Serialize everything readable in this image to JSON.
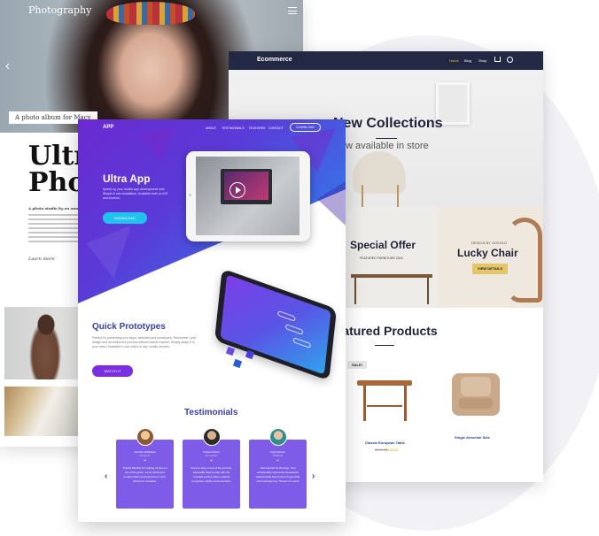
{
  "photography": {
    "logo": "Photography",
    "caption": "A photo album for Macy",
    "title": "Ultra\nPhot",
    "subtitle": "A photo studio by an award wi",
    "learn_more": "Learn more"
  },
  "ecommerce": {
    "logo": "Ecommerce",
    "nav": [
      "Home",
      "Blog",
      "Shop"
    ],
    "hero_title": "New Collections",
    "hero_sub": "Now available in store",
    "offer_title": "Special Offer",
    "offer_sub": "FEATURED FURNITURE 2016",
    "lucky_pre": "DESIGN BY GOSOLO",
    "lucky_title": "Lucky Chair",
    "lucky_button": "VIEW DETAILS",
    "featured_title": "Featured Products",
    "sale_badge": "SALE!",
    "products": [
      {
        "name": "Classic European Table",
        "old_price": "$500.00",
        "price": "$100.00"
      },
      {
        "name": "Single Armchair Sale"
      }
    ]
  },
  "app": {
    "logo": "APP",
    "nav": [
      "ABOUT",
      "TESTIMONIALS",
      "FEATURES",
      "CONTACT"
    ],
    "nav_download": "DOWNLOAD",
    "hero_title": "Ultra App",
    "hero_desc": "Speed up your mobile app development now. Simple & mix installation. Available both on iOS and Android.",
    "hero_button": "DOWNLOAD",
    "qp_title": "Quick Prototypes",
    "qp_desc": "Perfect for presenting your apps, websites and prototypes. Remember: your design and development process without hassle experts. Simply adapt it to your need. Available to use online or any mobile devices.",
    "qp_button": "WATCH IT",
    "testimonials_title": "Testimonials",
    "testimonials": [
      {
        "name": "Jennifer Matthews",
        "role": "Designer",
        "text": "Thanks Flexible for helping us step on top of the game, we've developed product faster and learned so much, thanks for complete."
      },
      {
        "name": "Robert Morris",
        "role": "Developer",
        "text": "Great to stay on top of the process. Especially liked to play with the Tutorials section when creating properties. Highly recommended."
      },
      {
        "name": "Kelly Santos",
        "role": "Marketer",
        "text": "Just inspired for Rovings. Your unbelievably expressive developers shared cards they'll never forget what client actually buy. Thanks so much!"
      }
    ]
  },
  "colors": {
    "app_purple": "#6a2ad0",
    "app_blue": "#29a5e8",
    "eco_navy": "#232845",
    "eco_accent": "#f2c21a",
    "card_purple": "#7e5ce8"
  }
}
